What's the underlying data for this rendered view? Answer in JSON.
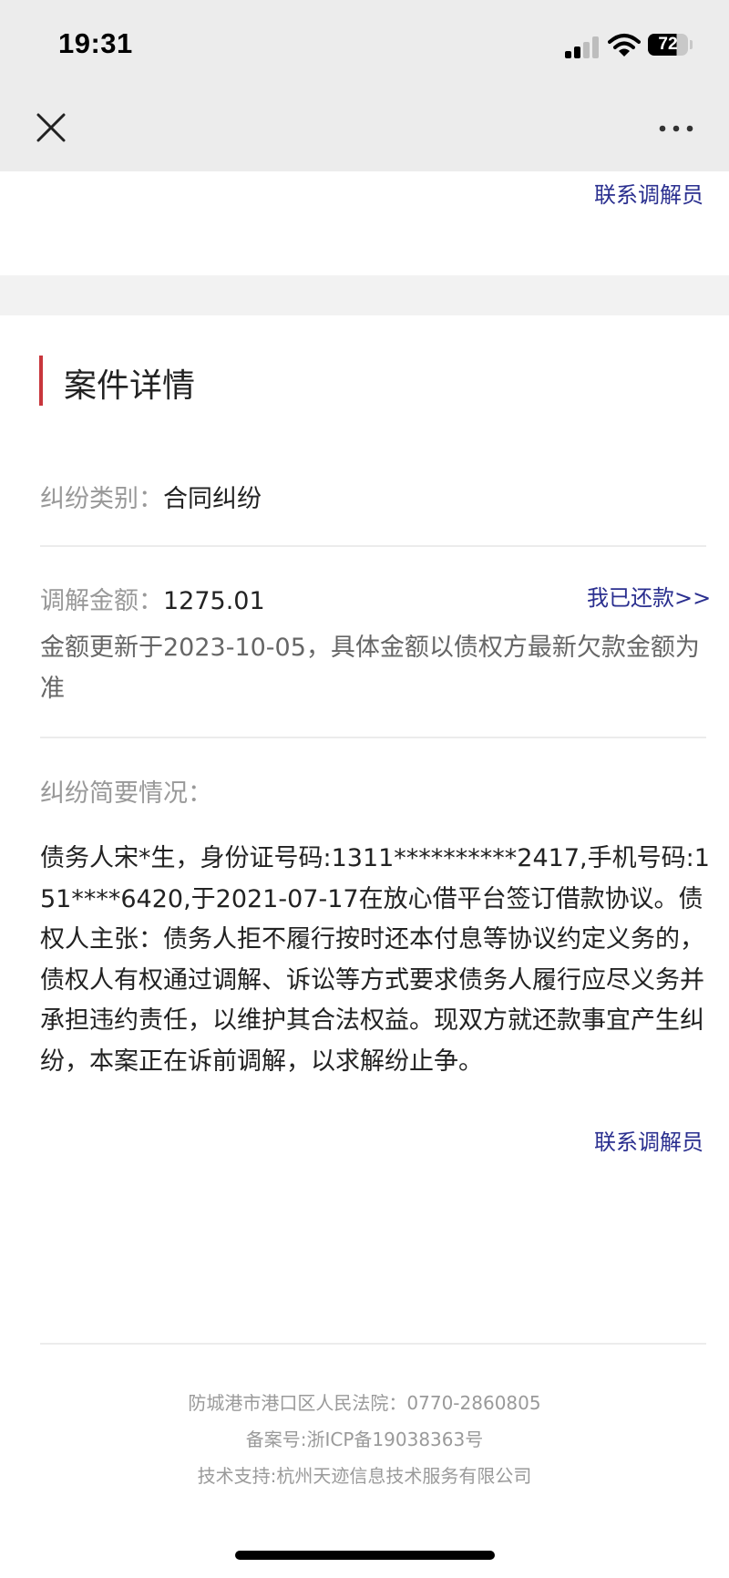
{
  "status_bar": {
    "time": "19:31",
    "battery": "72"
  },
  "nav": {
    "close_icon": "close-icon",
    "more_icon": "more-icon"
  },
  "top_contact_link": "联系调解员",
  "case_section": {
    "title": "案件详情",
    "accent_color": "#c8363c",
    "dispute_type_label": "纠纷类别：",
    "dispute_type_value": "合同纠纷",
    "amount_label": "调解金额：",
    "amount_value": "1275.01",
    "repaid_link": "我已还款>>",
    "amount_note": "金额更新于2023-10-05，具体金额以债权方最新欠款金额为准",
    "summary_label": "纠纷简要情况：",
    "summary_text": "债务人宋*生，身份证号码:1311**********2417,手机号码:151****6420,于2021-07-17在放心借平台签订借款协议。债权人主张：债务人拒不履行按时还本付息等协议约定义务的，债权人有权通过调解、诉讼等方式要求债务人履行应尽义务并承担违约责任，以维护其合法权益。现双方就还款事宜产生纠纷，本案正在诉前调解，以求解纷止争。",
    "contact_link": "联系调解员"
  },
  "footer": {
    "court": "防城港市港口区人民法院：0770-2860805",
    "icp": "备案号:浙ICP备19038363号",
    "support": "技术支持:杭州天迹信息技术服务有限公司"
  },
  "colors": {
    "link": "#2a2f8f",
    "label_gray": "#999999"
  }
}
